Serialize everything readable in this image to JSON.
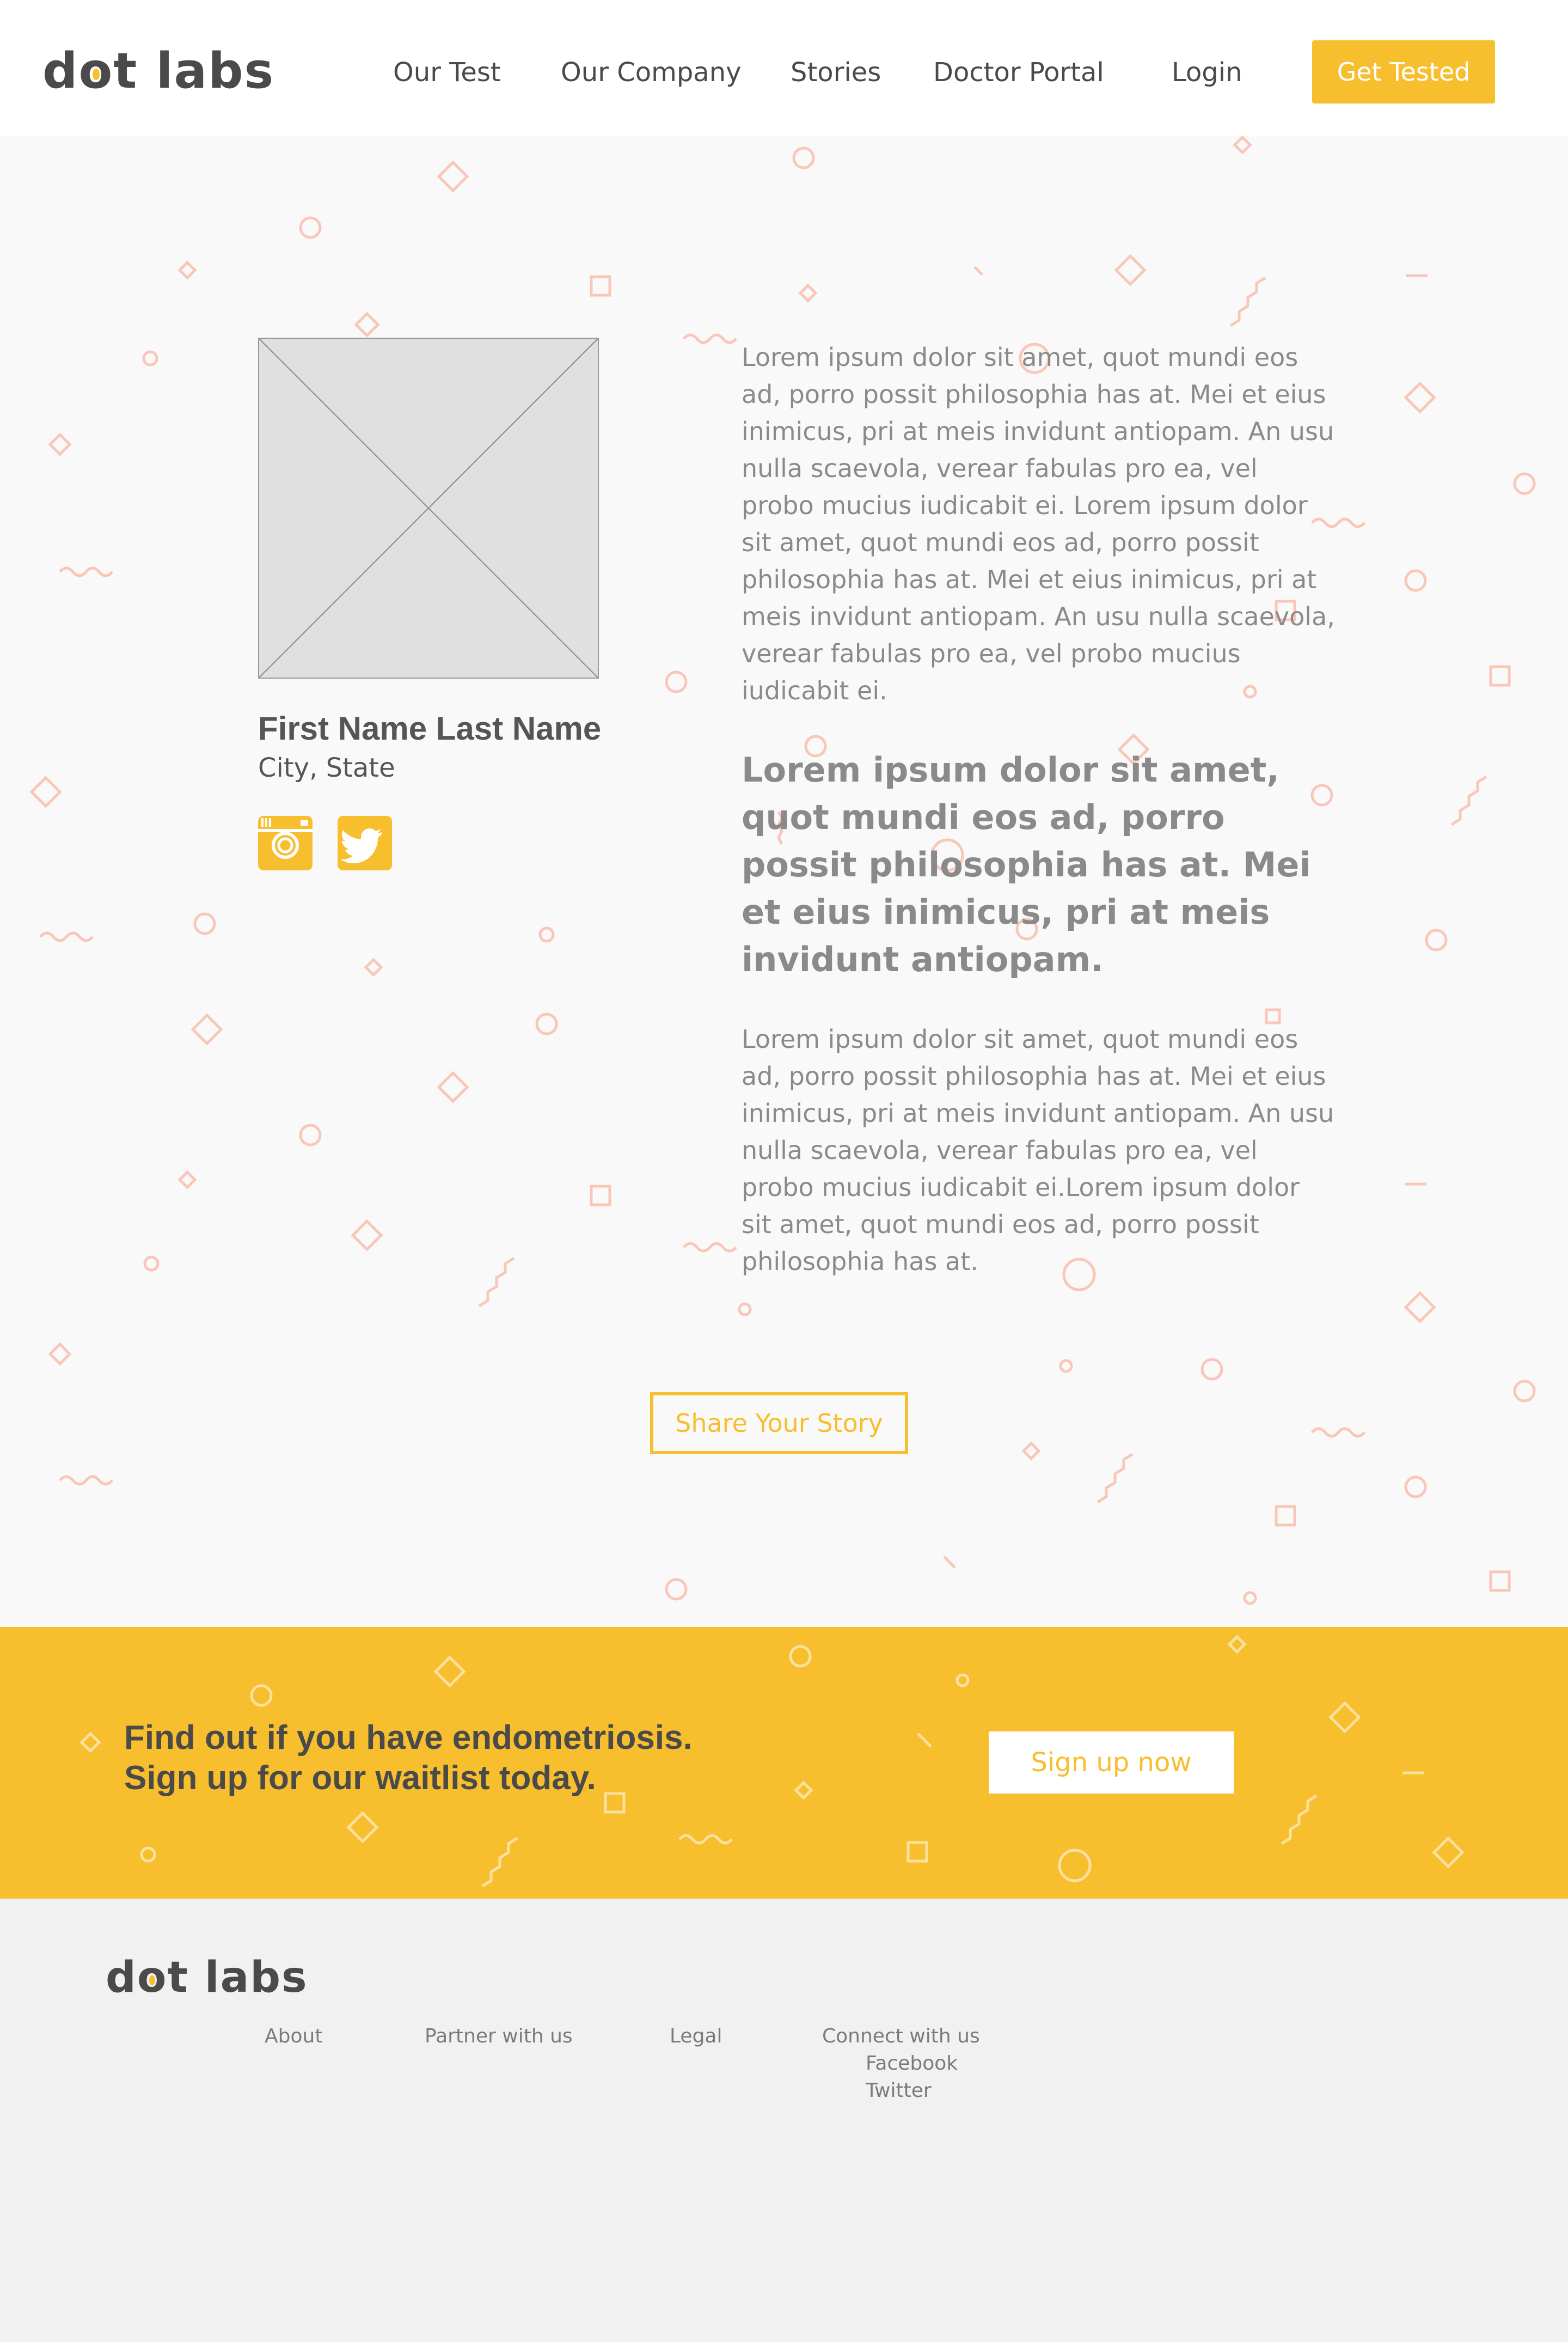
{
  "brand": {
    "logo_text_before": "d",
    "logo_text_o": "o",
    "logo_text_after": "t labs",
    "accent_color": "#f7bf2e",
    "decor_color": "#f9c6b8"
  },
  "header": {
    "nav": [
      "Our Test",
      "Our Company",
      "Stories",
      "Doctor Portal"
    ],
    "login_label": "Login",
    "cta_label": "Get Tested"
  },
  "profile": {
    "name": "First Name Last Name",
    "location": "City, State",
    "photo_icon": "image-placeholder-icon",
    "social": [
      {
        "icon": "instagram-icon"
      },
      {
        "icon": "twitter-icon"
      }
    ]
  },
  "story": {
    "paragraph_1": "Lorem ipsum dolor sit amet, quot mundi eos ad, porro possit philosophia has at. Mei et eius inimicus, pri at meis invidunt antiopam. An usu nulla scaevola, verear fabulas pro ea, vel probo mucius iudicabit ei. Lorem ipsum dolor sit amet, quot mundi eos ad, porro possit philosophia has at. Mei et eius inimicus, pri at meis invidunt antiopam. An usu nulla scaevola, verear fabulas pro ea, vel probo mucius iudicabit ei.",
    "pull_quote": "Lorem ipsum dolor sit amet, quot mundi eos ad, porro possit philosophia has at. Mei et eius inimicus, pri at meis invidunt antiopam.",
    "paragraph_2": "Lorem ipsum dolor sit amet, quot mundi eos ad, porro possit philosophia has at. Mei et eius inimicus, pri at meis invidunt antiopam. An usu nulla scaevola, verear fabulas pro ea, vel probo mucius iudicabit ei.Lorem ipsum dolor sit amet, quot mundi eos ad, porro possit philosophia has at.",
    "share_label": "Share Your Story"
  },
  "cta_band": {
    "line_1": "Find out if you have endometriosis.",
    "line_2": "Sign up for our waitlist today.",
    "button_label": "Sign up now"
  },
  "footer": {
    "links": [
      "About",
      "Partner with us",
      "Legal"
    ],
    "connect_heading": "Connect with us",
    "connect_links": [
      "Facebook",
      "Twitter"
    ]
  }
}
